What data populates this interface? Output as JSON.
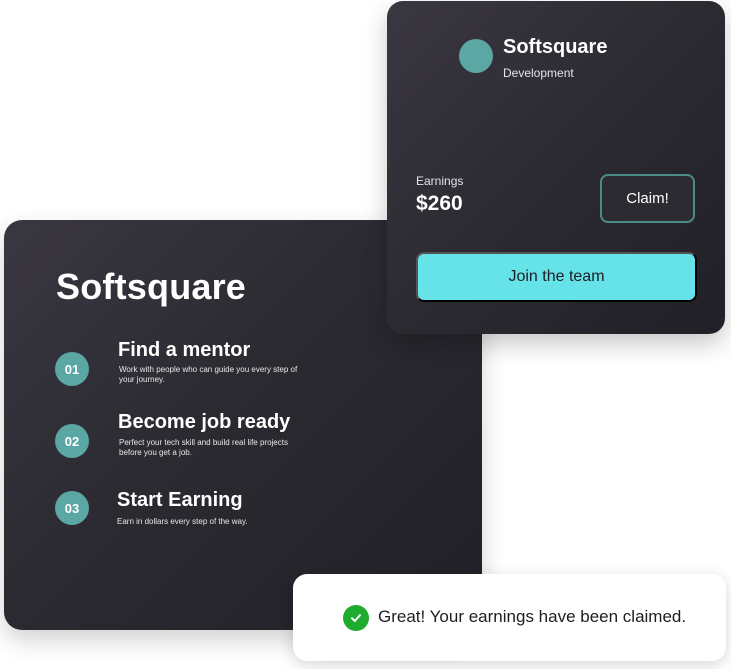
{
  "main_card": {
    "title": "Softsquare",
    "steps": [
      {
        "number": "01",
        "title": "Find a mentor",
        "description": "Work with people who can guide you every step of your journey."
      },
      {
        "number": "02",
        "title": "Become job ready",
        "description": "Perfect your tech skill and build real life projects before you get a job."
      },
      {
        "number": "03",
        "title": "Start Earning",
        "description": "Earn in dollars every step of the way."
      }
    ]
  },
  "team_card": {
    "company_name": "Softsquare",
    "company_subtitle": "Development",
    "earnings_label": "Earnings",
    "earnings_value": "$260",
    "claim_label": "Claim!",
    "join_label": "Join the team"
  },
  "toast": {
    "message": "Great! Your earnings have been claimed.",
    "icon": "check-circle-icon"
  },
  "colors": {
    "card_background": "#2c2a31",
    "accent_teal": "#5ba7a3",
    "button_cyan": "#66e3e8",
    "success_green": "#1fab2e"
  }
}
